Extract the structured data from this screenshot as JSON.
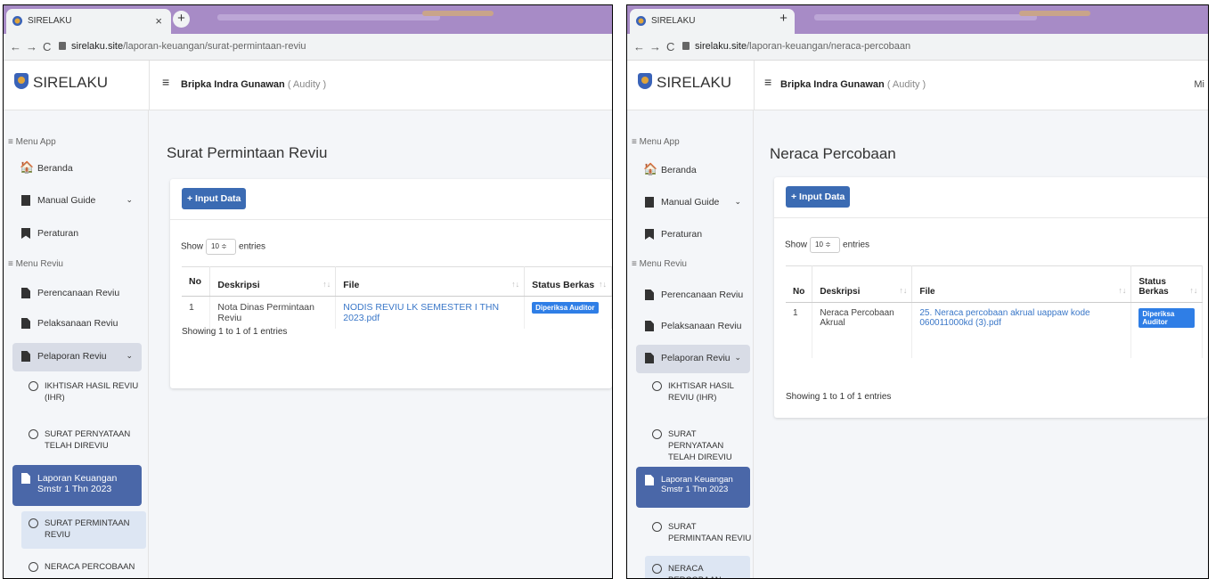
{
  "browser": {
    "tab_title": "SIRELAKU",
    "tab_close": "×",
    "new_tab": "+",
    "back": "←",
    "forward": "→",
    "reload": "C"
  },
  "app": {
    "brand": "SIRELAKU",
    "user_name": "Bripka Indra Gunawan",
    "user_role": "( Audity )",
    "menu_app_label": "≡ Menu App",
    "menu_reviu_label": "≡ Menu Reviu",
    "menu": {
      "beranda": "Beranda",
      "manual_guide": "Manual Guide",
      "peraturan": "Peraturan",
      "perencanaan": "Perencanaan Reviu",
      "pelaksanaan": "Pelaksanaan Reviu",
      "pelaporan": "Pelaporan Reviu",
      "ihr": "IKHTISAR HASIL REVIU (IHR)",
      "spr": "SURAT PERNYATAAN TELAH DIREVIU",
      "laporan": "Laporan Keuangan Smstr 1 Thn 2023",
      "spr_reviu": "SURAT PERMINTAAN REVIU",
      "neraca": "NERACA PERCOBAAN"
    },
    "input_button": "+ Input Data",
    "show_label": "Show",
    "entries_value": "10 ≑",
    "entries_label": "entries",
    "col_no": "No",
    "col_desc": "Deskripsi",
    "col_file": "File",
    "sort_icon": "↑↓"
  },
  "left": {
    "url_domain": "sirelaku.site",
    "url_path": "/laporan-keuangan/surat-permintaan-reviu",
    "page_title": "Surat Permintaan Reviu",
    "col_status": "Status Berkas",
    "rows": [
      {
        "no": "1",
        "desc": "Nota Dinas Permintaan Reviu",
        "file": "NODIS REVIU LK SEMESTER I THN 2023.pdf",
        "status": "Diperiksa Auditor"
      }
    ],
    "footer": "Showing 1 to 1 of 1 entries"
  },
  "right": {
    "url_domain": "sirelaku.site",
    "url_path": "/laporan-keuangan/neraca-percobaan",
    "page_title": "Neraca Percobaan",
    "col_status": "Status Berkas",
    "topbar_right": "Mi",
    "rows": [
      {
        "no": "1",
        "desc": "Neraca Percobaan Akrual",
        "file": "25. Neraca percobaan akrual uappaw kode 060011000kd (3).pdf",
        "status": "Diperiksa Auditor"
      }
    ],
    "footer": "Showing 1 to 1 of 1 entries"
  }
}
